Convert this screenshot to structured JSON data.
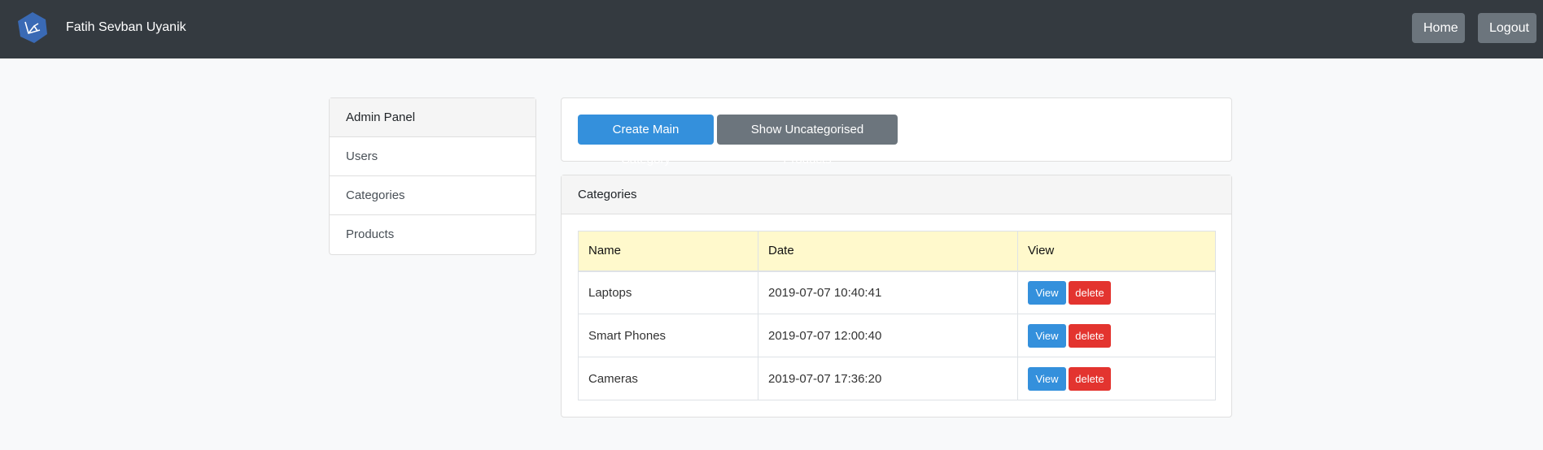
{
  "navbar": {
    "brand_name": "Fatih Sevban Uyanik",
    "home_label": "Home",
    "logout_label": "Logout",
    "logo_icon": "laravel-logo-icon"
  },
  "sidebar": {
    "heading": "Admin Panel",
    "items": [
      {
        "label": "Users"
      },
      {
        "label": "Categories"
      },
      {
        "label": "Products"
      }
    ]
  },
  "actions": {
    "create_label": "Create Main Category",
    "uncategorised_label": "Show Uncategorised Products"
  },
  "categories_card": {
    "heading": "Categories",
    "columns": [
      "Name",
      "Date",
      "View"
    ],
    "rows": [
      {
        "name": "Laptops",
        "date": "2019-07-07 10:40:41",
        "view_label": "View",
        "delete_label": "delete"
      },
      {
        "name": "Smart Phones",
        "date": "2019-07-07 12:00:40",
        "view_label": "View",
        "delete_label": "delete"
      },
      {
        "name": "Cameras",
        "date": "2019-07-07 17:36:20",
        "view_label": "View",
        "delete_label": "delete"
      }
    ]
  },
  "colors": {
    "navbar": "#343a40",
    "primary": "#3490dc",
    "secondary": "#6c757d",
    "danger": "#e3342f",
    "table_header": "#fff9cc"
  }
}
